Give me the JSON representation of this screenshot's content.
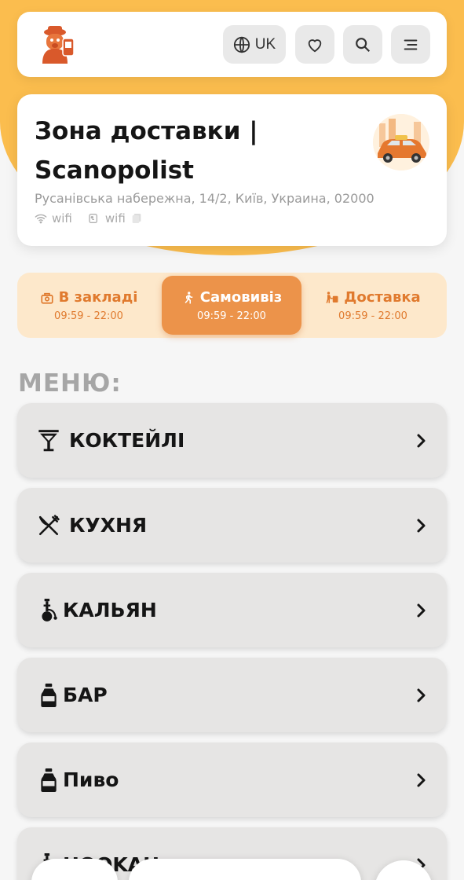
{
  "brand": {
    "accent": "#fbbd4e",
    "active_mode": "#ec934a",
    "mode_bg": "#fde8cb",
    "mode_text": "#e07a2e"
  },
  "topbar": {
    "logo_icon": "dog-detective-logo-icon",
    "language": "UK",
    "icons": [
      "globe-icon",
      "heart-icon",
      "search-icon",
      "menu-icon"
    ]
  },
  "venue": {
    "title": "Зона доставки | Scanopolist",
    "address": "Русанівська набережна, 14/2, Київ, Украина, 02000",
    "wifi_name": "wifi",
    "wifi_password": "wifi"
  },
  "modes": [
    {
      "label": "В закладі",
      "hours": "09:59 - 22:00",
      "icon": "restaurant-icon",
      "active": false
    },
    {
      "label": "Самовивіз",
      "hours": "09:59 - 22:00",
      "icon": "walking-icon",
      "active": true
    },
    {
      "label": "Доставка",
      "hours": "09:59 - 22:00",
      "icon": "delivery-icon",
      "active": false
    }
  ],
  "menu": {
    "heading": "МЕНЮ:",
    "categories": [
      {
        "label": "КОКТЕЙЛІ",
        "icon": "cocktail-icon"
      },
      {
        "label": "КУХНЯ",
        "icon": "utensils-icon"
      },
      {
        "label": "КАЛЬЯН",
        "icon": "hookah-icon"
      },
      {
        "label": "БАР",
        "icon": "bottle-icon"
      },
      {
        "label": "Пиво",
        "icon": "bottle-icon"
      },
      {
        "label": "HOOKAH",
        "icon": "hookah-icon"
      }
    ]
  }
}
